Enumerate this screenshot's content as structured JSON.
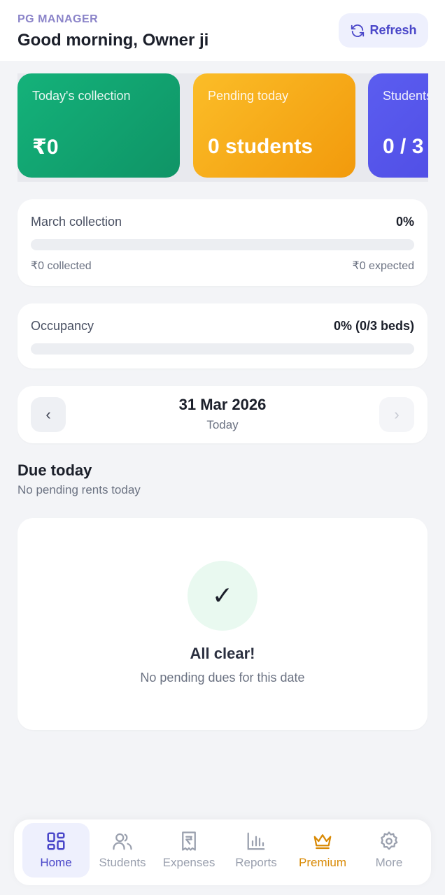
{
  "header": {
    "brand": "PG MANAGER",
    "greeting": "Good morning, Owner ji",
    "refresh_label": "Refresh",
    "refresh_icon": "refresh-icon"
  },
  "stat_cards": [
    {
      "label": "Today's collection",
      "value": "₹0",
      "color": "#0f9466"
    },
    {
      "label": "Pending today",
      "value": "0 students",
      "color": "#f29a0c"
    },
    {
      "label": "Students",
      "value": "0 / 3",
      "color": "#4b47e0"
    }
  ],
  "monthly": {
    "label": "March collection",
    "percent_text": "0%",
    "progress": 0,
    "collected": "₹0 collected",
    "expected": "₹0 expected"
  },
  "occupancy": {
    "label": "Occupancy",
    "value_text": "0% (0/3 beds)",
    "progress": 0
  },
  "date_nav": {
    "prev_symbol": "‹",
    "next_symbol": "›",
    "date": "31 Mar 2026",
    "sub": "Today"
  },
  "due_section": {
    "title": "Due today",
    "subtitle": "No pending rents today"
  },
  "empty_state": {
    "check_symbol": "✓",
    "title": "All clear!",
    "subtitle": "No pending dues for this date"
  },
  "bottom_nav": [
    {
      "label": "Home",
      "icon": "grid-icon",
      "active": true
    },
    {
      "label": "Students",
      "icon": "users-icon"
    },
    {
      "label": "Expenses",
      "icon": "receipt-rupee-icon"
    },
    {
      "label": "Reports",
      "icon": "bar-chart-icon"
    },
    {
      "label": "Premium",
      "icon": "crown-icon",
      "color": "#d98a06"
    },
    {
      "label": "More",
      "icon": "gear-icon"
    }
  ],
  "colors": {
    "accent": "#4a47c9",
    "background": "#f3f4f7",
    "success": "#14b27a",
    "warning": "#f29a0c"
  }
}
